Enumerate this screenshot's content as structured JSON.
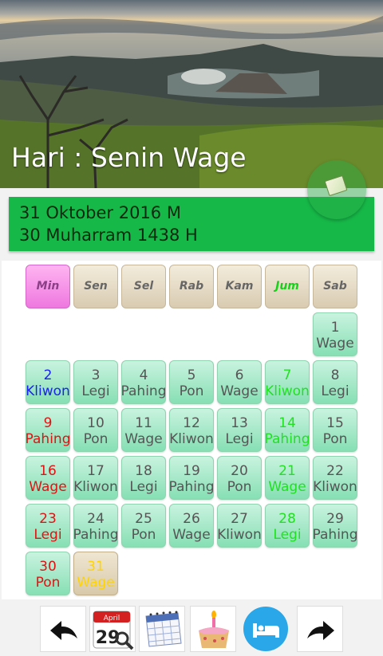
{
  "header": {
    "day_title": "Hari : Senin Wage"
  },
  "banner": {
    "gregorian": "31 Oktober 2016 M",
    "hijri": "30 Muharram 1438 H"
  },
  "weekdays": [
    "Min",
    "Sen",
    "Sel",
    "Rab",
    "Kam",
    "Jum",
    "Sab"
  ],
  "weeks": [
    [
      null,
      null,
      null,
      null,
      null,
      null,
      {
        "day": "1",
        "pasaran": "Wage"
      }
    ],
    [
      {
        "day": "2",
        "pasaran": "Kliwon"
      },
      {
        "day": "3",
        "pasaran": "Legi"
      },
      {
        "day": "4",
        "pasaran": "Pahing"
      },
      {
        "day": "5",
        "pasaran": "Pon"
      },
      {
        "day": "6",
        "pasaran": "Wage"
      },
      {
        "day": "7",
        "pasaran": "Kliwon"
      },
      {
        "day": "8",
        "pasaran": "Legi"
      }
    ],
    [
      {
        "day": "9",
        "pasaran": "Pahing"
      },
      {
        "day": "10",
        "pasaran": "Pon"
      },
      {
        "day": "11",
        "pasaran": "Wage"
      },
      {
        "day": "12",
        "pasaran": "Kliwon"
      },
      {
        "day": "13",
        "pasaran": "Legi"
      },
      {
        "day": "14",
        "pasaran": "Pahing"
      },
      {
        "day": "15",
        "pasaran": "Pon"
      }
    ],
    [
      {
        "day": "16",
        "pasaran": "Wage"
      },
      {
        "day": "17",
        "pasaran": "Kliwon"
      },
      {
        "day": "18",
        "pasaran": "Legi"
      },
      {
        "day": "19",
        "pasaran": "Pahing"
      },
      {
        "day": "20",
        "pasaran": "Pon"
      },
      {
        "day": "21",
        "pasaran": "Wage"
      },
      {
        "day": "22",
        "pasaran": "Kliwon"
      }
    ],
    [
      {
        "day": "23",
        "pasaran": "Legi"
      },
      {
        "day": "24",
        "pasaran": "Pahing"
      },
      {
        "day": "25",
        "pasaran": "Pon"
      },
      {
        "day": "26",
        "pasaran": "Wage"
      },
      {
        "day": "27",
        "pasaran": "Kliwon"
      },
      {
        "day": "28",
        "pasaran": "Legi"
      },
      {
        "day": "29",
        "pasaran": "Pahing"
      }
    ],
    [
      {
        "day": "30",
        "pasaran": "Pon"
      },
      {
        "day": "31",
        "pasaran": "Wage",
        "today": true
      },
      null,
      null,
      null,
      null,
      null
    ]
  ],
  "colors": {
    "sunday": "#dd1414",
    "friday": "#22e022",
    "today": "#ffd400",
    "kliwon_sunday": "#1a22ee",
    "default": "#555555",
    "banner": "#16b948"
  },
  "toolbar": {
    "buttons": [
      "back-arrow-icon",
      "calendar-search-icon",
      "calendar-grid-icon",
      "birthday-cake-icon",
      "bed-icon",
      "forward-arrow-icon"
    ],
    "calendar_icon_month": "April",
    "calendar_icon_day": "29"
  }
}
